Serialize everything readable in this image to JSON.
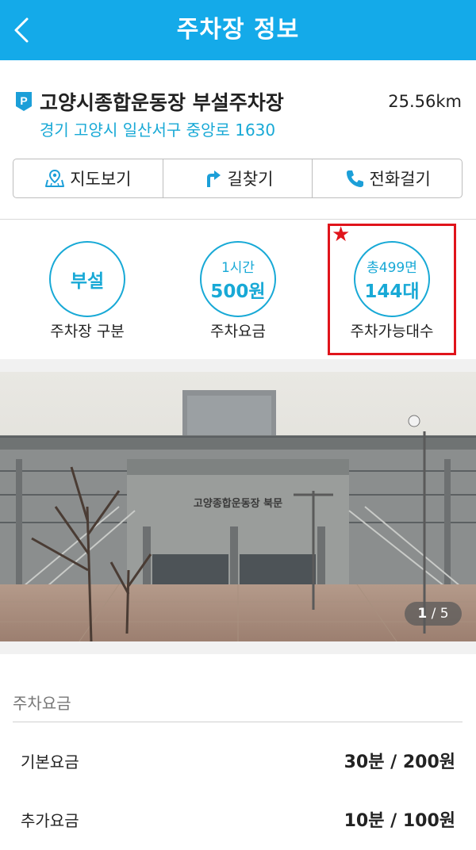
{
  "appbar": {
    "title": "주차장 정보",
    "back_icon": "chevron-left-icon"
  },
  "parking": {
    "name": "고양시종합운동장 부설주차장",
    "distance": "25.56km",
    "address": "경기 고양시 일산서구 중앙로 1630",
    "badge_icon": "parking-icon"
  },
  "actions": [
    {
      "label": "지도보기",
      "icon": "map-icon"
    },
    {
      "label": "길찾기",
      "icon": "turn-right-icon"
    },
    {
      "label": "전화걸기",
      "icon": "phone-icon"
    }
  ],
  "stats": {
    "type": {
      "value": "부설",
      "label": "주차장 구분"
    },
    "fee": {
      "line1": "1시간",
      "line2": "500원",
      "label": "주차요금"
    },
    "available": {
      "line1": "총499면",
      "line2": "144대",
      "label": "주차가능대수"
    }
  },
  "photo": {
    "current": "1",
    "total": "/ 5",
    "sign_text": "고양종합운동장 북문"
  },
  "fees": {
    "section_title": "주차요금",
    "rows": [
      {
        "label": "기본요금",
        "value": "30분 / 200원"
      },
      {
        "label": "추가요금",
        "value": "10분 / 100원"
      }
    ]
  },
  "colors": {
    "primary": "#14aae9",
    "accent_text": "#18a9d6",
    "highlight": "#e0141b"
  }
}
